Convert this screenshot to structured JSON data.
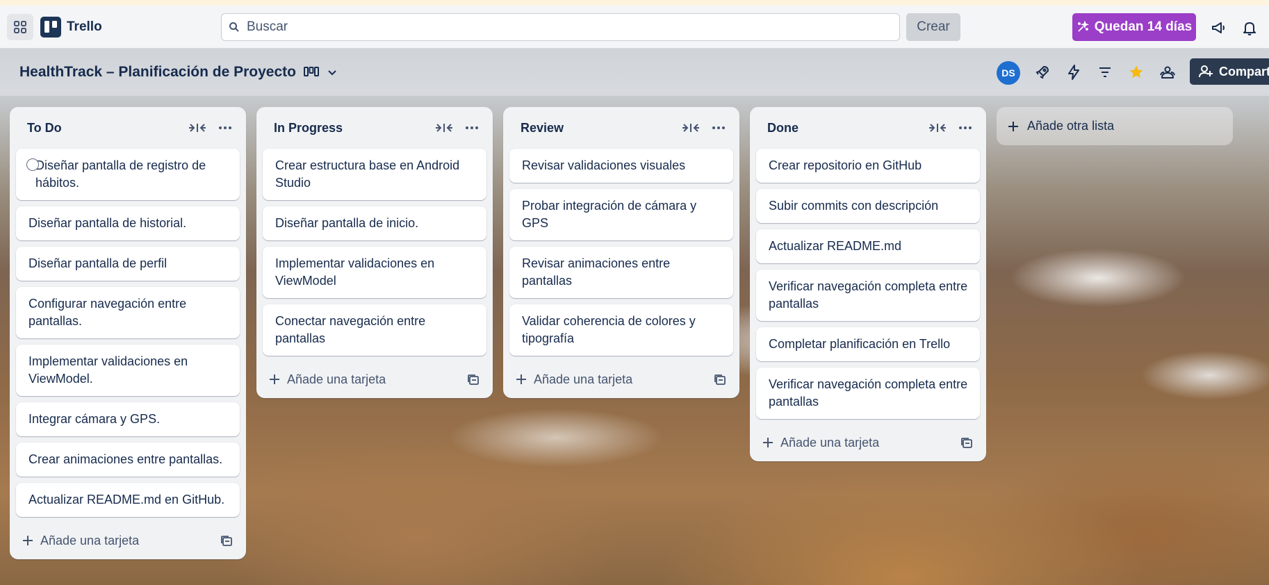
{
  "header": {
    "app_name": "Trello",
    "search_placeholder": "Buscar",
    "create_label": "Crear",
    "trial_label": "Quedan 14 días"
  },
  "board": {
    "title": "HealthTrack – Planificación de Proyecto",
    "avatar_initials": "DS",
    "share_label": "Compartir"
  },
  "lists": [
    {
      "title": "To Do",
      "cards": [
        "Diseñar pantalla de registro de hábitos.",
        "Diseñar pantalla de historial.",
        "Diseñar pantalla de perfil",
        "Configurar navegación entre pantallas.",
        "Implementar validaciones en ViewModel.",
        "Integrar cámara y GPS.",
        "Crear animaciones entre pantallas.",
        "Actualizar README.md en GitHub."
      ],
      "add_card_label": "Añade una tarjeta"
    },
    {
      "title": "In Progress",
      "cards": [
        "Crear estructura base en Android Studio",
        "Diseñar pantalla de inicio.",
        "Implementar validaciones en ViewModel",
        "Conectar navegación entre pantallas"
      ],
      "add_card_label": "Añade una tarjeta"
    },
    {
      "title": "Review",
      "cards": [
        "Revisar validaciones visuales",
        "Probar integración de cámara y GPS",
        "Revisar animaciones entre pantallas",
        "Validar coherencia de colores y tipografía"
      ],
      "add_card_label": "Añade una tarjeta"
    },
    {
      "title": "Done",
      "cards": [
        "Crear repositorio en GitHub",
        "Subir commits con descripción",
        "Actualizar README.md",
        "Verificar navegación completa entre pantallas",
        "Completar planificación en Trello",
        "Verificar navegación completa entre pantallas"
      ],
      "add_card_label": "Añade una tarjeta"
    }
  ],
  "add_list_label": "Añade otra lista",
  "colors": {
    "trial_purple": "#9b3ec8",
    "avatar_blue": "#1f6fd1",
    "star_yellow": "#f5b90f",
    "list_bg": "#f1f2f4"
  }
}
